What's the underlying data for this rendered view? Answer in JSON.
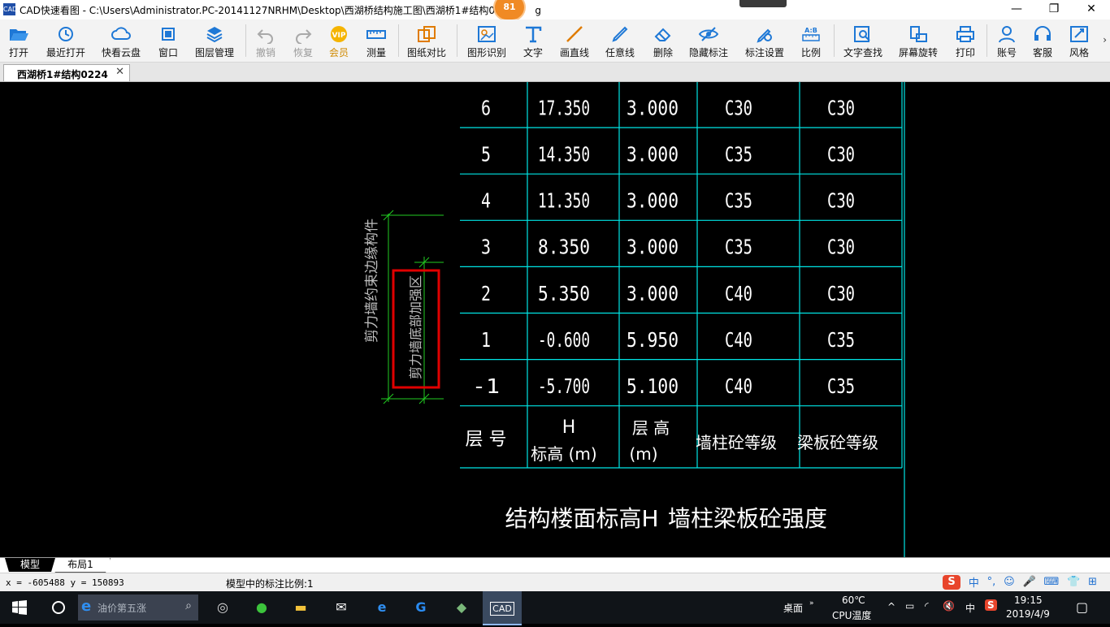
{
  "window": {
    "app_icon_text": "CAD",
    "title": "CAD快速看图 - C:\\Users\\Administrator.PC-20141127NRHM\\Desktop\\西湖桥结构施工图\\西湖桥1#结构022",
    "title_tail": "g",
    "notification_badge": "81",
    "minimize": "—",
    "maximize": "❐",
    "close": "✕"
  },
  "toolbar": {
    "items": [
      {
        "label": "打开",
        "icon": "folder-open-icon"
      },
      {
        "label": "最近打开",
        "icon": "history-icon"
      },
      {
        "label": "快看云盘",
        "icon": "cloud-icon"
      },
      {
        "label": "窗口",
        "icon": "window-icon"
      },
      {
        "label": "图层管理",
        "icon": "layers-icon"
      },
      {
        "label": "撤销",
        "icon": "undo-icon"
      },
      {
        "label": "恢复",
        "icon": "redo-icon"
      },
      {
        "label": "会员",
        "icon": "vip-icon"
      },
      {
        "label": "测量",
        "icon": "ruler-icon"
      },
      {
        "label": "图纸对比",
        "icon": "compare-icon"
      },
      {
        "label": "图形识别",
        "icon": "shape-recognize-icon"
      },
      {
        "label": "文字",
        "icon": "text-icon"
      },
      {
        "label": "画直线",
        "icon": "line-icon"
      },
      {
        "label": "任意线",
        "icon": "pen-icon"
      },
      {
        "label": "删除",
        "icon": "eraser-icon"
      },
      {
        "label": "隐藏标注",
        "icon": "hide-eye-icon"
      },
      {
        "label": "标注设置",
        "icon": "annotation-settings-icon"
      },
      {
        "label": "比例",
        "icon": "scale-icon"
      },
      {
        "label": "文字查找",
        "icon": "text-search-icon"
      },
      {
        "label": "屏幕旋转",
        "icon": "rotate-screen-icon"
      },
      {
        "label": "打印",
        "icon": "printer-icon"
      },
      {
        "label": "账号",
        "icon": "account-icon"
      },
      {
        "label": "客服",
        "icon": "headset-icon"
      },
      {
        "label": "风格",
        "icon": "style-icon"
      }
    ],
    "more": "›"
  },
  "tabs": {
    "document": "西湖桥1#结构0224",
    "close": "✕"
  },
  "drawing": {
    "rows": [
      {
        "floor": "6",
        "elev": "17.350",
        "height": "3.000",
        "wall": "C30",
        "slab": "C30"
      },
      {
        "floor": "5",
        "elev": "14.350",
        "height": "3.000",
        "wall": "C35",
        "slab": "C30"
      },
      {
        "floor": "4",
        "elev": "11.350",
        "height": "3.000",
        "wall": "C35",
        "slab": "C30"
      },
      {
        "floor": "3",
        "elev": "8.350",
        "height": "3.000",
        "wall": "C35",
        "slab": "C30"
      },
      {
        "floor": "2",
        "elev": "5.350",
        "height": "3.000",
        "wall": "C40",
        "slab": "C30"
      },
      {
        "floor": "1",
        "elev": "-0.600",
        "height": "5.950",
        "wall": "C40",
        "slab": "C35"
      },
      {
        "floor": "-1",
        "elev": "-5.700",
        "height": "5.100",
        "wall": "C40",
        "slab": "C35"
      }
    ],
    "header": {
      "floor": "层 号",
      "elev_h": "H",
      "elev": "标高 (m)",
      "height_a": "层 高",
      "height_b": "(m)",
      "wall": "墙柱砼等级",
      "slab": "梁板砼等级"
    },
    "caption_left": "结构楼面标高H",
    "caption_right": "墙柱梁板砼强度",
    "side_label_outer": "剪力墙约束边缘构件",
    "side_label_inner": "剪力墙底部加强区",
    "colors": {
      "grid": "#00e5e5",
      "text": "#ffffff",
      "highlight": "#e00000",
      "dim": "#22cc22"
    }
  },
  "layout_tabs": {
    "model": "模型",
    "layout1": "布局1"
  },
  "status": {
    "coords": "x = -605488  y = 150893",
    "scale": "模型中的标注比例:1",
    "ime_items": [
      "中",
      "°,",
      "☺",
      "🎤",
      "⌨",
      "👕",
      "⊞"
    ],
    "ime_logo": "S"
  },
  "taskbar": {
    "search_placeholder": "油价第五涨",
    "desktop": "桌面",
    "cpu_temp": "60℃",
    "cpu_label": "CPU温度",
    "lang": "中",
    "time": "19:15",
    "date": "2019/4/9",
    "cad_label": "CAD"
  }
}
